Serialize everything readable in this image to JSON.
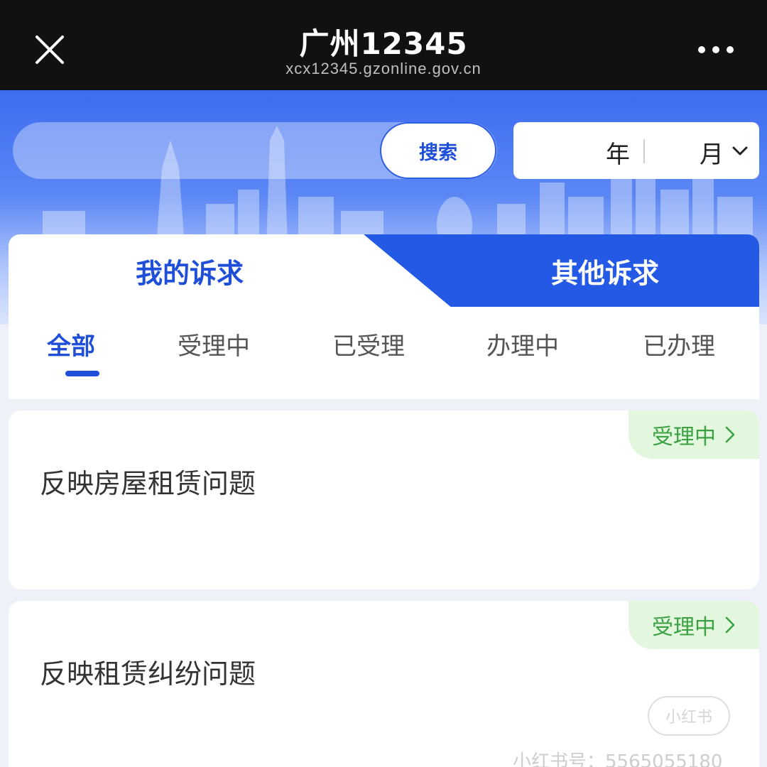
{
  "header": {
    "title": "广州12345",
    "url": "xcx12345.gzonline.gov.cn"
  },
  "search": {
    "placeholder": "",
    "button_label": "搜索"
  },
  "date_picker": {
    "year_label": "年",
    "month_label": "月"
  },
  "tabs": [
    {
      "label": "我的诉求",
      "active": true
    },
    {
      "label": "其他诉求",
      "active": false
    }
  ],
  "filters": [
    {
      "label": "全部",
      "active": true
    },
    {
      "label": "受理中",
      "active": false
    },
    {
      "label": "已受理",
      "active": false
    },
    {
      "label": "办理中",
      "active": false
    },
    {
      "label": "已办理",
      "active": false
    }
  ],
  "complaints": [
    {
      "title": "反映房屋租赁问题",
      "status": "受理中"
    },
    {
      "title": "反映租赁纠纷问题",
      "status": "受理中"
    }
  ],
  "watermark": {
    "logo_text": "小红书",
    "id_text": "小红书号：5565055180"
  },
  "colors": {
    "primary": "#2459e6",
    "status_bg": "#e3f7de",
    "status_text": "#3aa142"
  }
}
